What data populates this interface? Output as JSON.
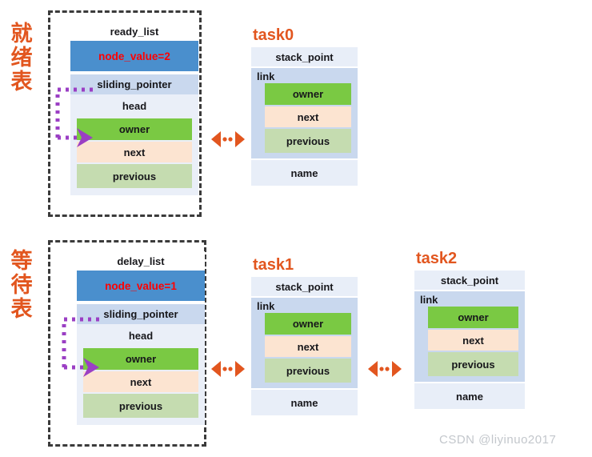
{
  "diagram": {
    "title": "RTOS ready_list / delay_list and task control block linkage",
    "colors": {
      "accent_orange": "#e2561f",
      "node_value_blue": "#4a8fcd",
      "node_value_text_red": "#ff0000",
      "owner_green": "#7ac943",
      "next_peach": "#fce4d1",
      "previous_green": "#c5dcb0",
      "link_blue": "#c9d8ee",
      "panel_light": "#e8eef8",
      "dashed_border": "#3b3b3b",
      "purple_arrow": "#9b3fc4",
      "watermark_grey": "#c3c7cc"
    }
  },
  "sections": [
    {
      "side_label_chars": [
        "就",
        "绪",
        "表"
      ],
      "side_label_text": "就绪表",
      "list": {
        "title": "ready_list",
        "node_value": "node_value=2",
        "sliding_pointer": "sliding_pointer",
        "head": "head",
        "owner": "owner",
        "next": "next",
        "previous": "previous"
      },
      "tasks": [
        {
          "title": "task0",
          "stack_point": "stack_point",
          "link": "link",
          "owner": "owner",
          "next": "next",
          "previous": "previous",
          "name": "name"
        }
      ]
    },
    {
      "side_label_chars": [
        "等",
        "待",
        "表"
      ],
      "side_label_text": "等待表",
      "list": {
        "title": "delay_list",
        "node_value": "node_value=1",
        "sliding_pointer": "sliding_pointer",
        "head": "head",
        "owner": "owner",
        "next": "next",
        "previous": "previous"
      },
      "tasks": [
        {
          "title": "task1",
          "stack_point": "stack_point",
          "link": "link",
          "owner": "owner",
          "next": "next",
          "previous": "previous",
          "name": "name"
        },
        {
          "title": "task2",
          "stack_point": "stack_point",
          "link": "link",
          "owner": "owner",
          "next": "next",
          "previous": "previous",
          "name": "name"
        }
      ]
    }
  ],
  "watermark": "CSDN @liyinuo2017"
}
